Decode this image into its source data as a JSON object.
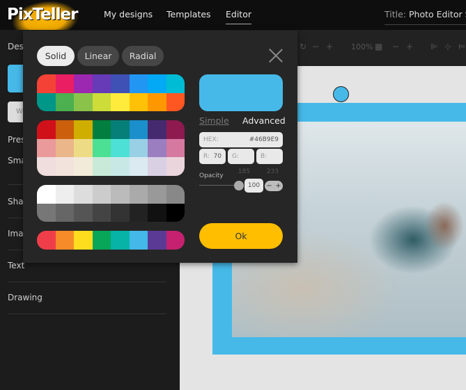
{
  "nav": {
    "logo": "PixTeller",
    "items": [
      "My designs",
      "Templates",
      "Editor"
    ],
    "active": "Editor",
    "title_label": "Title:",
    "title_value": "Photo Editor Sc"
  },
  "sidebar": {
    "items": [
      "Des",
      "W",
      "Pres",
      "Sma",
      "Sha",
      "Ima",
      "Text",
      "Drawing"
    ],
    "swatch_color": "#46B9E9"
  },
  "toolbar": {
    "zoom": "100%"
  },
  "picker": {
    "tabs": [
      "Solid",
      "Linear",
      "Radial"
    ],
    "active_tab": "Solid",
    "palettes": [
      [
        "#F44336",
        "#E91E63",
        "#9C27B0",
        "#673AB7",
        "#3F51B5",
        "#2196F3",
        "#03A9F4",
        "#00BCD4",
        "#009688",
        "#4CAF50",
        "#8BC34A",
        "#CDDC39",
        "#FFEB3B",
        "#FFC107",
        "#FF9800",
        "#FF5722"
      ],
      [
        "#D0111A",
        "#CB5F0B",
        "#CFAE00",
        "#027F3E",
        "#067F78",
        "#1B8FCB",
        "#452A70",
        "#8E1A50",
        "#EA9A9A",
        "#EAB68A",
        "#EDDC85",
        "#4BE094",
        "#4DE0D6",
        "#9AD0E6",
        "#9A7EC0",
        "#D679A0",
        "#EFDEDD",
        "#F2E3DC",
        "#F2EBD9",
        "#C9EAD8",
        "#C8E8E6",
        "#DAEAF0",
        "#D9D0E4",
        "#EBD5DC"
      ],
      [
        "#FFFFFF",
        "#EEEEEE",
        "#DDDDDD",
        "#CCCCCC",
        "#BBBBBB",
        "#AAAAAA",
        "#999999",
        "#888888",
        "#777777",
        "#666666",
        "#555555",
        "#444444",
        "#333333",
        "#222222",
        "#111111",
        "#000000"
      ],
      [
        "#EF3E4A",
        "#F68B29",
        "#FEDD1F",
        "#08A659",
        "#07B3A6",
        "#44B8E8",
        "#5B3A96",
        "#C62170"
      ]
    ],
    "current_color": "#46B9E9",
    "modes": [
      "Simple",
      "Advanced"
    ],
    "active_mode": "Advanced",
    "hex_label": "HEX:",
    "hex": "#46B9E9",
    "r_label": "R:",
    "r": "70",
    "g_label": "G:",
    "g": "185",
    "b_label": "B:",
    "b": "233",
    "opacity_label": "Opacity",
    "opacity": "100",
    "minus": "−",
    "plus": "+",
    "ok": "Ok"
  }
}
